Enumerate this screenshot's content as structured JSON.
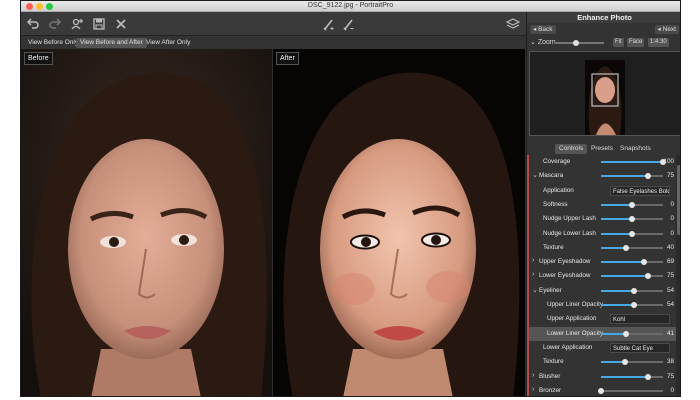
{
  "window": {
    "title": "DSC_9122.jpg - PortraitPro"
  },
  "view_tabs": [
    "View Before Only",
    "View Before and After",
    "View After Only"
  ],
  "labels": {
    "before": "Before",
    "after": "After"
  },
  "panel": {
    "title": "Enhance Photo",
    "back": "Back",
    "next": "Next",
    "zoom_label": "Zoom",
    "fit": "Fit",
    "face": "Face",
    "ratio": "1:4.30",
    "zoom_value": 0.35,
    "tabs": [
      "Controls",
      "Presets",
      "Snapshots"
    ]
  },
  "controls": [
    {
      "label": "Coverage",
      "value": "100",
      "level": 1.0,
      "kind": "slider"
    },
    {
      "label": "Mascara",
      "value": "75",
      "level": 0.75,
      "kind": "parent-open"
    },
    {
      "label": "Application",
      "select": "False Eyelashes Bold",
      "kind": "select"
    },
    {
      "label": "Softness",
      "value": "0",
      "level": 0.5,
      "kind": "slider"
    },
    {
      "label": "Nudge Upper Lash",
      "value": "0",
      "level": 0.5,
      "kind": "slider"
    },
    {
      "label": "Nudge Lower Lash",
      "value": "0",
      "level": 0.5,
      "kind": "slider"
    },
    {
      "label": "Texture",
      "value": "40",
      "level": 0.4,
      "kind": "slider"
    },
    {
      "label": "Upper Eyeshadow",
      "value": "69",
      "level": 0.69,
      "kind": "parent"
    },
    {
      "label": "Lower Eyeshadow",
      "value": "75",
      "level": 0.75,
      "kind": "parent"
    },
    {
      "label": "Eyeliner",
      "value": "54",
      "level": 0.54,
      "kind": "parent-open"
    },
    {
      "label": "Upper Liner Opacity",
      "value": "54",
      "level": 0.54,
      "kind": "sub"
    },
    {
      "label": "Upper Application",
      "select": "Kohl",
      "kind": "select-sub"
    },
    {
      "label": "Lower Liner Opacity",
      "value": "41",
      "level": 0.41,
      "kind": "sub",
      "highlight": true
    },
    {
      "label": "Lower Application",
      "select": "Subtle Cat Eye",
      "kind": "select"
    },
    {
      "label": "Texture",
      "value": "38",
      "level": 0.38,
      "kind": "slider"
    },
    {
      "label": "Blusher",
      "value": "75",
      "level": 0.75,
      "kind": "parent"
    },
    {
      "label": "Bronzer",
      "value": "0",
      "level": 0.0,
      "kind": "parent"
    }
  ],
  "icons": [
    "undo-icon",
    "redo-icon",
    "add-person-icon",
    "save-icon",
    "close-icon",
    "brush-add-icon",
    "brush-remove-icon",
    "layers-icon"
  ],
  "colors": {
    "slider_fill": "#47a8e6",
    "section_marker": "#b84c4c"
  }
}
